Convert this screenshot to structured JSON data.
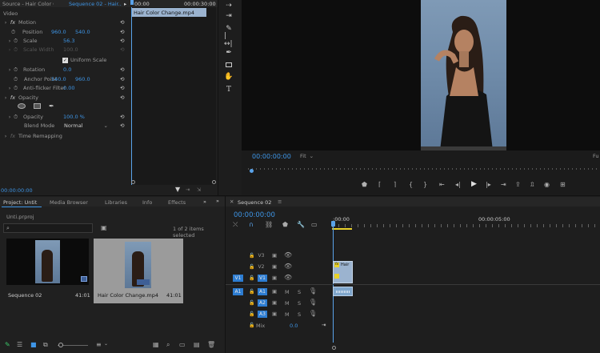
{
  "effect_controls": {
    "source_tab": "Source - Hair Color Ch",
    "sequence_tab": "Sequence 02 - Hair...",
    "header_time_start": "00:00",
    "header_time_end": "00:00:30:00",
    "clip_name": "Hair Color Change.mp4",
    "video_label": "Video",
    "motion": "Motion",
    "position_label": "Position",
    "position_x": "960.0",
    "position_y": "540.0",
    "scale_label": "Scale",
    "scale_value": "56.3",
    "scale_width_label": "Scale Width",
    "scale_width_value": "100.0",
    "uniform_scale": "Uniform Scale",
    "rotation_label": "Rotation",
    "rotation_value": "0.0",
    "anchor_label": "Anchor Point",
    "anchor_x": "540.0",
    "anchor_y": "960.0",
    "antiflicker_label": "Anti-flicker Filter",
    "antiflicker_value": "0.00",
    "opacity_header": "Opacity",
    "opacity_label": "Opacity",
    "opacity_value": "100.0 %",
    "blend_label": "Blend Mode",
    "blend_value": "Normal",
    "time_remap": "Time Remapping",
    "footer_time": "00:00:00:00"
  },
  "program_monitor": {
    "timecode": "00:00:00:00",
    "fit": "Fit",
    "fit_right": "Fu"
  },
  "project_panel": {
    "tabs": [
      "Project: Untit",
      "Media Browser",
      "Libraries",
      "Info",
      "Effects"
    ],
    "more": "»",
    "project_file": "Unti.prproj",
    "items_selected": "1 of 2 items selected",
    "items": [
      {
        "name": "Sequence 02",
        "duration": "41:01"
      },
      {
        "name": "Hair Color Change.mp4",
        "duration": "41:01"
      }
    ]
  },
  "timeline": {
    "tab": "Sequence 02",
    "timecode": "00:00:00:00",
    "ruler_start": ":00:00",
    "ruler_mid": "00:00:05:00",
    "video_tracks": [
      {
        "src": "",
        "name": "V3"
      },
      {
        "src": "",
        "name": "V2"
      },
      {
        "src": "V1",
        "name": "V1"
      }
    ],
    "audio_tracks": [
      {
        "src": "A1",
        "name": "A1"
      },
      {
        "src": "",
        "name": "A2"
      },
      {
        "src": "",
        "name": "A3"
      }
    ],
    "mix_label": "Mix",
    "mix_value": "0.0",
    "clip_label": "Hair",
    "clip_fx": "fx"
  },
  "colors": {
    "accent": "#3e95e6",
    "selection": "#2d7dd2",
    "clip_video": "#9bb3cf",
    "clip_audio": "#7fa6cc",
    "playhead": "#5aa3ea",
    "workarea": "#e8d12a"
  }
}
